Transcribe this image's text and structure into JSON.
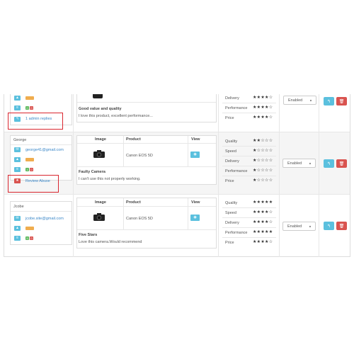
{
  "colors": {
    "info": "#5bc0de",
    "danger": "#d9534f",
    "success": "#5cb85c",
    "warning": "#f0ad4e",
    "highlight": "#d9262f"
  },
  "headers": {
    "image": "Image",
    "product": "Product",
    "view": "View"
  },
  "labels": {
    "quality": "Quality",
    "speed": "Speed",
    "delivery": "Delivery",
    "performance": "Performance",
    "price": "Price"
  },
  "reviews": [
    {
      "author": "",
      "email": "",
      "badge_green": "0",
      "badge_red": "0",
      "link": "1 admin replies",
      "link_icon": "reply-icon",
      "product": "",
      "title": "Good value and quality",
      "text": "I love this product, excellent performance...",
      "ratings": {
        "delivery": 4,
        "performance": 4,
        "price": 4
      },
      "status": "Enabled"
    },
    {
      "author": "George",
      "email": "george41@gmail.com",
      "badge_green": "1",
      "badge_red": "0",
      "link": "Review Abuse",
      "link_icon": "star-icon",
      "product": "Canon EOS 5D",
      "title": "Faulty Camera",
      "text": "I can't use this not properly working.",
      "ratings": {
        "quality": 2,
        "speed": 1,
        "delivery": 1,
        "performance": 1,
        "price": 1
      },
      "status": "Enabled"
    },
    {
      "author": "Jcobe",
      "email": "jcobe.site@gmail.com",
      "badge_green": "5",
      "badge_red": "0",
      "link": "",
      "link_icon": "",
      "product": "Canon EOS 5D",
      "title": "Five Stars",
      "text": "Love this camera.Would recommend",
      "ratings": {
        "quality": 5,
        "speed": 4,
        "delivery": 4,
        "performance": 5,
        "price": 4
      },
      "status": "Enabled"
    }
  ]
}
